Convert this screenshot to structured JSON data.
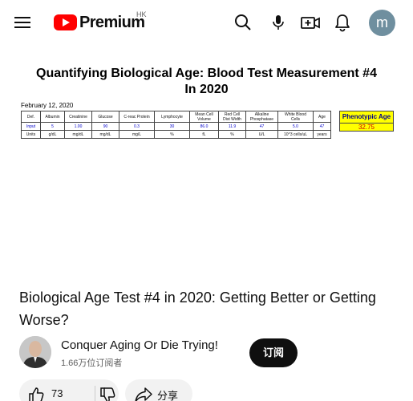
{
  "header": {
    "brand": "Premium",
    "region": "HK",
    "avatar_letter": "m",
    "icons": [
      "menu-icon",
      "youtube-logo-icon",
      "search-icon",
      "microphone-icon",
      "create-video-icon",
      "notifications-bell-icon"
    ]
  },
  "colors": {
    "brand_red": "#ff0000",
    "avatar_bg": "#6f8f9f",
    "subscribe_bg": "#0f0f0f",
    "pill_bg": "#f2f2f2",
    "highlight_yellow": "#ffff00"
  },
  "video_frame": {
    "title_line1": "Quantifying Biological Age: Blood Test Measurement #4",
    "title_line2": "In 2020",
    "date": "February 12, 2020",
    "table_headers": [
      "Def.",
      "Albumin",
      "Creatinine",
      "Glucose",
      "C-reac Protein",
      "Lymphocyte",
      "Mean Cell Volume",
      "Red Cell Dist Width",
      "Alkaline Phosphatase",
      "White Blood Cells",
      "Age"
    ],
    "row_input": [
      "Input",
      "5",
      "1.00",
      "90",
      "0.3",
      "30",
      "86.0",
      "11.9",
      "47",
      "5.0",
      "47"
    ],
    "row_units": [
      "Units",
      "g/dL",
      "mg/dL",
      "mg/dL",
      "mg/L",
      "%",
      "fL",
      "%",
      "U/L",
      "10^3 cells/uL",
      "years"
    ],
    "phenotypic_label": "Phenotypic Age",
    "phenotypic_value": "32.75"
  },
  "video": {
    "title": "Biological Age Test #4 in 2020: Getting Better or Getting Worse?"
  },
  "channel": {
    "name": "Conquer Aging Or Die Trying!",
    "subscribers": "1.66万位订阅者",
    "subscribe_label": "订阅"
  },
  "actions": {
    "like_count": "73",
    "share_label": "分享"
  }
}
